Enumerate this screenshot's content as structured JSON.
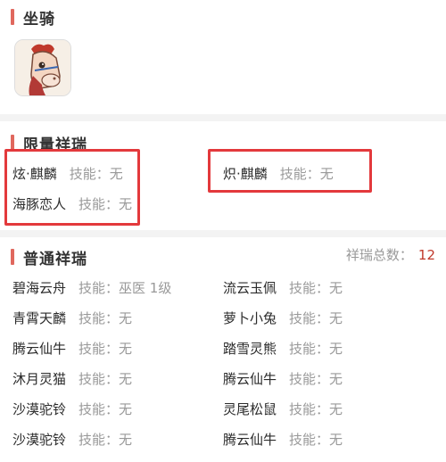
{
  "sections": {
    "mount": {
      "title": "坐骑",
      "icon": "horse-mount-icon"
    },
    "limited": {
      "title": "限量祥瑞",
      "items": [
        {
          "name": "炫·麒麟",
          "skill": "技能：无"
        },
        {
          "name": "炽·麒麟",
          "skill": "技能：无"
        },
        {
          "name": "海豚恋人",
          "skill": "技能：无"
        }
      ]
    },
    "normal": {
      "title": "普通祥瑞",
      "total_label": "祥瑞总数：",
      "total_value": "12",
      "items": [
        {
          "name": "碧海云舟",
          "skill": "技能：巫医 1级"
        },
        {
          "name": "流云玉佩",
          "skill": "技能：无"
        },
        {
          "name": "青霄天麟",
          "skill": "技能：无"
        },
        {
          "name": "萝卜小兔",
          "skill": "技能：无"
        },
        {
          "name": "腾云仙牛",
          "skill": "技能：无"
        },
        {
          "name": "踏雪灵熊",
          "skill": "技能：无"
        },
        {
          "name": "沐月灵猫",
          "skill": "技能：无"
        },
        {
          "name": "腾云仙牛",
          "skill": "技能：无"
        },
        {
          "name": "沙漠驼铃",
          "skill": "技能：无"
        },
        {
          "name": "灵尾松鼠",
          "skill": "技能：无"
        },
        {
          "name": "沙漠驼铃",
          "skill": "技能：无"
        },
        {
          "name": "腾云仙牛",
          "skill": "技能：无"
        }
      ]
    }
  },
  "colors": {
    "accent": "#e0685e",
    "highlight": "#e3393c",
    "muted": "#999999",
    "count": "#c0392b"
  }
}
